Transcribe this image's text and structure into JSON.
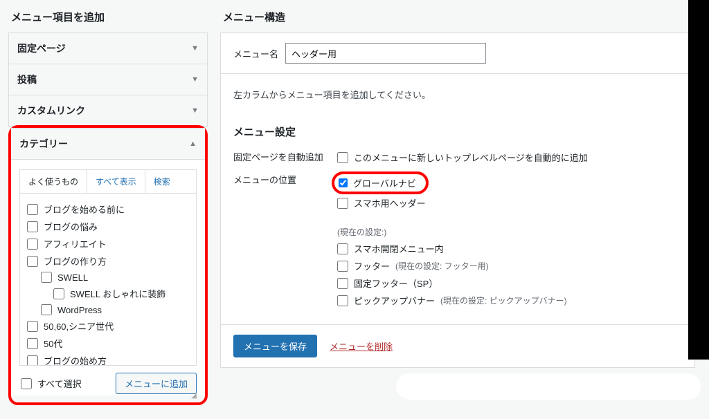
{
  "left": {
    "title": "メニュー項目を追加",
    "sections": {
      "pages": "固定ページ",
      "posts": "投稿",
      "custom": "カスタムリンク",
      "categories": "カテゴリー"
    },
    "tabs": {
      "frequent": "よく使うもの",
      "all": "すべて表示",
      "search": "検索"
    },
    "categories": [
      {
        "label": "ブログを始める前に",
        "indent": 0
      },
      {
        "label": "ブログの悩み",
        "indent": 0
      },
      {
        "label": "アフィリエイト",
        "indent": 0
      },
      {
        "label": "ブログの作り方",
        "indent": 0
      },
      {
        "label": "SWELL",
        "indent": 1
      },
      {
        "label": "SWELL おしゃれに装飾",
        "indent": 2
      },
      {
        "label": "WordPress",
        "indent": 1
      },
      {
        "label": "50,60,シニア世代",
        "indent": 0
      },
      {
        "label": "50代",
        "indent": 0
      },
      {
        "label": "ブログの始め方",
        "indent": 0
      }
    ],
    "select_all": "すべて選択",
    "add_button": "メニューに追加"
  },
  "right": {
    "title": "メニュー構造",
    "menu_name_label": "メニュー名",
    "menu_name_value": "ヘッダー用",
    "instruction": "左カラムからメニュー項目を追加してください。",
    "settings_title": "メニュー設定",
    "auto_add_label": "固定ページを自動追加",
    "auto_add_option": "このメニューに新しいトップレベルページを自動的に追加",
    "position_label": "メニューの位置",
    "positions": {
      "global": "グローバルナビ",
      "sp_header": "スマホ用ヘッダー",
      "current_note": "(現在の設定:)",
      "sp_drawer": "スマホ開閉メニュー内",
      "footer": "フッター",
      "footer_note": "(現在の設定: フッター用)",
      "fixed_footer": "固定フッター（SP）",
      "pickup": "ピックアップバナー",
      "pickup_note": "(現在の設定: ピックアップバナー)"
    },
    "save_button": "メニューを保存",
    "delete_link": "メニューを削除"
  }
}
